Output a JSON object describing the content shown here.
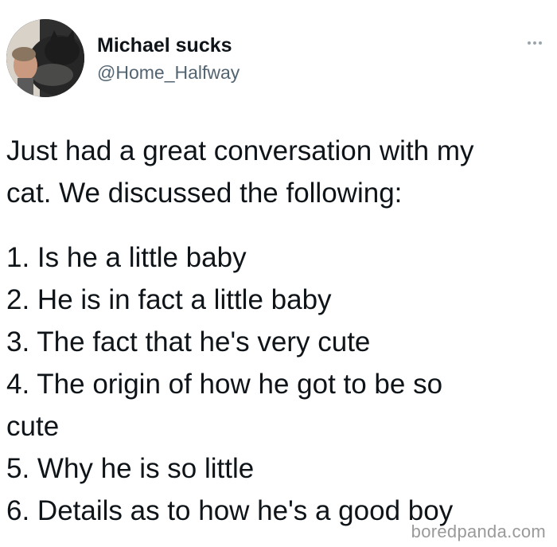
{
  "author": {
    "display_name": "Michael sucks",
    "handle": "@Home_Halfway"
  },
  "more_icon": "more-horizontal-icon",
  "tweet": {
    "intro_lines": [
      "Just had a great conversation with my",
      "cat. We discussed the following:"
    ],
    "list_lines": [
      "1. Is he a little baby",
      "2. He is in fact a little baby",
      "3. The fact that he's very cute",
      "4. The origin of how he got to be so",
      "cute",
      "5. Why he is so little",
      "6. Details as to how he's a good boy"
    ]
  },
  "watermark": "boredpanda.com",
  "colors": {
    "text": "#0f1419",
    "secondary_text": "#536471",
    "watermark": "#9a9a9a",
    "background": "#ffffff"
  }
}
